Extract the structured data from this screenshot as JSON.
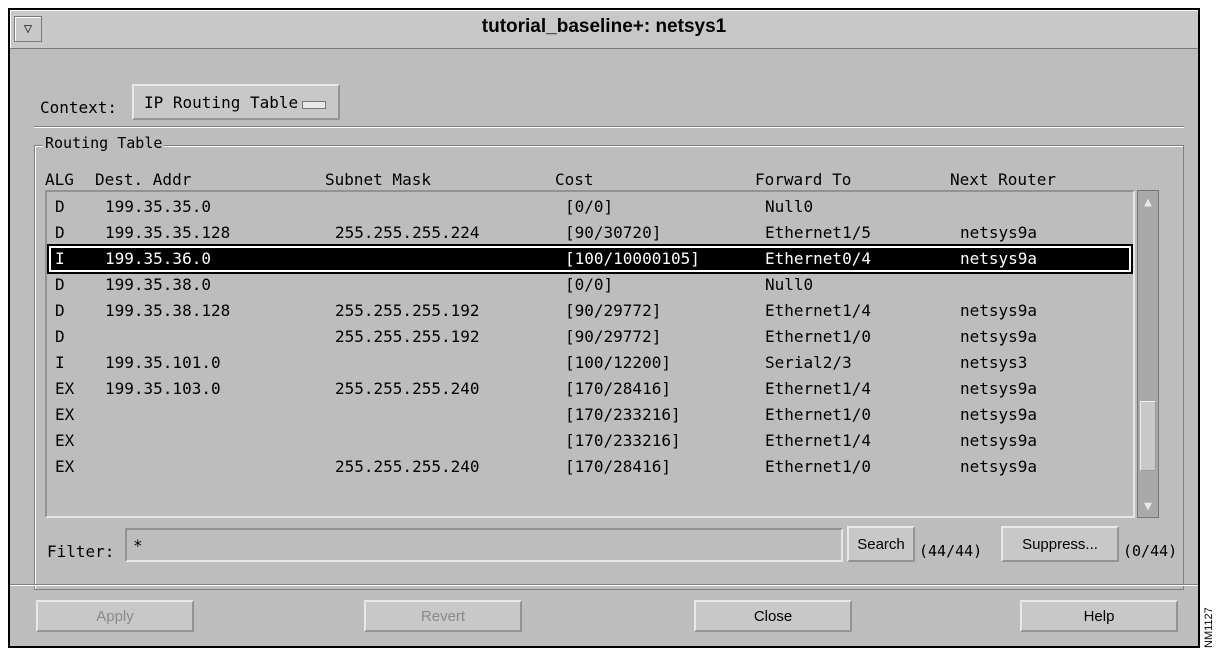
{
  "window": {
    "title": "tutorial_baseline+: netsys1"
  },
  "context": {
    "label": "Context:",
    "value": "IP Routing Table"
  },
  "routing_table": {
    "group_label": "Routing Table",
    "columns": [
      "ALG",
      "Dest. Addr",
      "Subnet Mask",
      "Cost",
      "Forward To",
      "Next Router"
    ],
    "rows": [
      {
        "alg": "D",
        "dest": "199.35.35.0",
        "mask": "",
        "cost": "[0/0]",
        "fwd": "Null0",
        "next": ""
      },
      {
        "alg": "D",
        "dest": "199.35.35.128",
        "mask": "255.255.255.224",
        "cost": "[90/30720]",
        "fwd": "Ethernet1/5",
        "next": "netsys9a"
      },
      {
        "alg": "I",
        "dest": "199.35.36.0",
        "mask": "",
        "cost": "[100/10000105]",
        "fwd": "Ethernet0/4",
        "next": "netsys9a",
        "selected": true
      },
      {
        "alg": "D",
        "dest": "199.35.38.0",
        "mask": "",
        "cost": "[0/0]",
        "fwd": "Null0",
        "next": ""
      },
      {
        "alg": "D",
        "dest": "199.35.38.128",
        "mask": "255.255.255.192",
        "cost": "[90/29772]",
        "fwd": "Ethernet1/4",
        "next": "netsys9a"
      },
      {
        "alg": "D",
        "dest": "",
        "mask": "255.255.255.192",
        "cost": "[90/29772]",
        "fwd": "Ethernet1/0",
        "next": "netsys9a"
      },
      {
        "alg": "I",
        "dest": "199.35.101.0",
        "mask": "",
        "cost": "[100/12200]",
        "fwd": "Serial2/3",
        "next": "netsys3"
      },
      {
        "alg": "EX",
        "dest": "199.35.103.0",
        "mask": "255.255.255.240",
        "cost": "[170/28416]",
        "fwd": "Ethernet1/4",
        "next": "netsys9a"
      },
      {
        "alg": "EX",
        "dest": "",
        "mask": "",
        "cost": "[170/233216]",
        "fwd": "Ethernet1/0",
        "next": "netsys9a"
      },
      {
        "alg": "EX",
        "dest": "",
        "mask": "",
        "cost": "[170/233216]",
        "fwd": "Ethernet1/4",
        "next": "netsys9a"
      },
      {
        "alg": "EX",
        "dest": "",
        "mask": "255.255.255.240",
        "cost": "[170/28416]",
        "fwd": "Ethernet1/0",
        "next": "netsys9a"
      }
    ]
  },
  "filter": {
    "label": "Filter:",
    "value": "*",
    "search_label": "Search",
    "search_count": "(44/44)",
    "suppress_label": "Suppress...",
    "suppress_count": "(0/44)"
  },
  "buttons": {
    "apply": "Apply",
    "revert": "Revert",
    "close": "Close",
    "help": "Help"
  },
  "figure_id": "NM1127"
}
